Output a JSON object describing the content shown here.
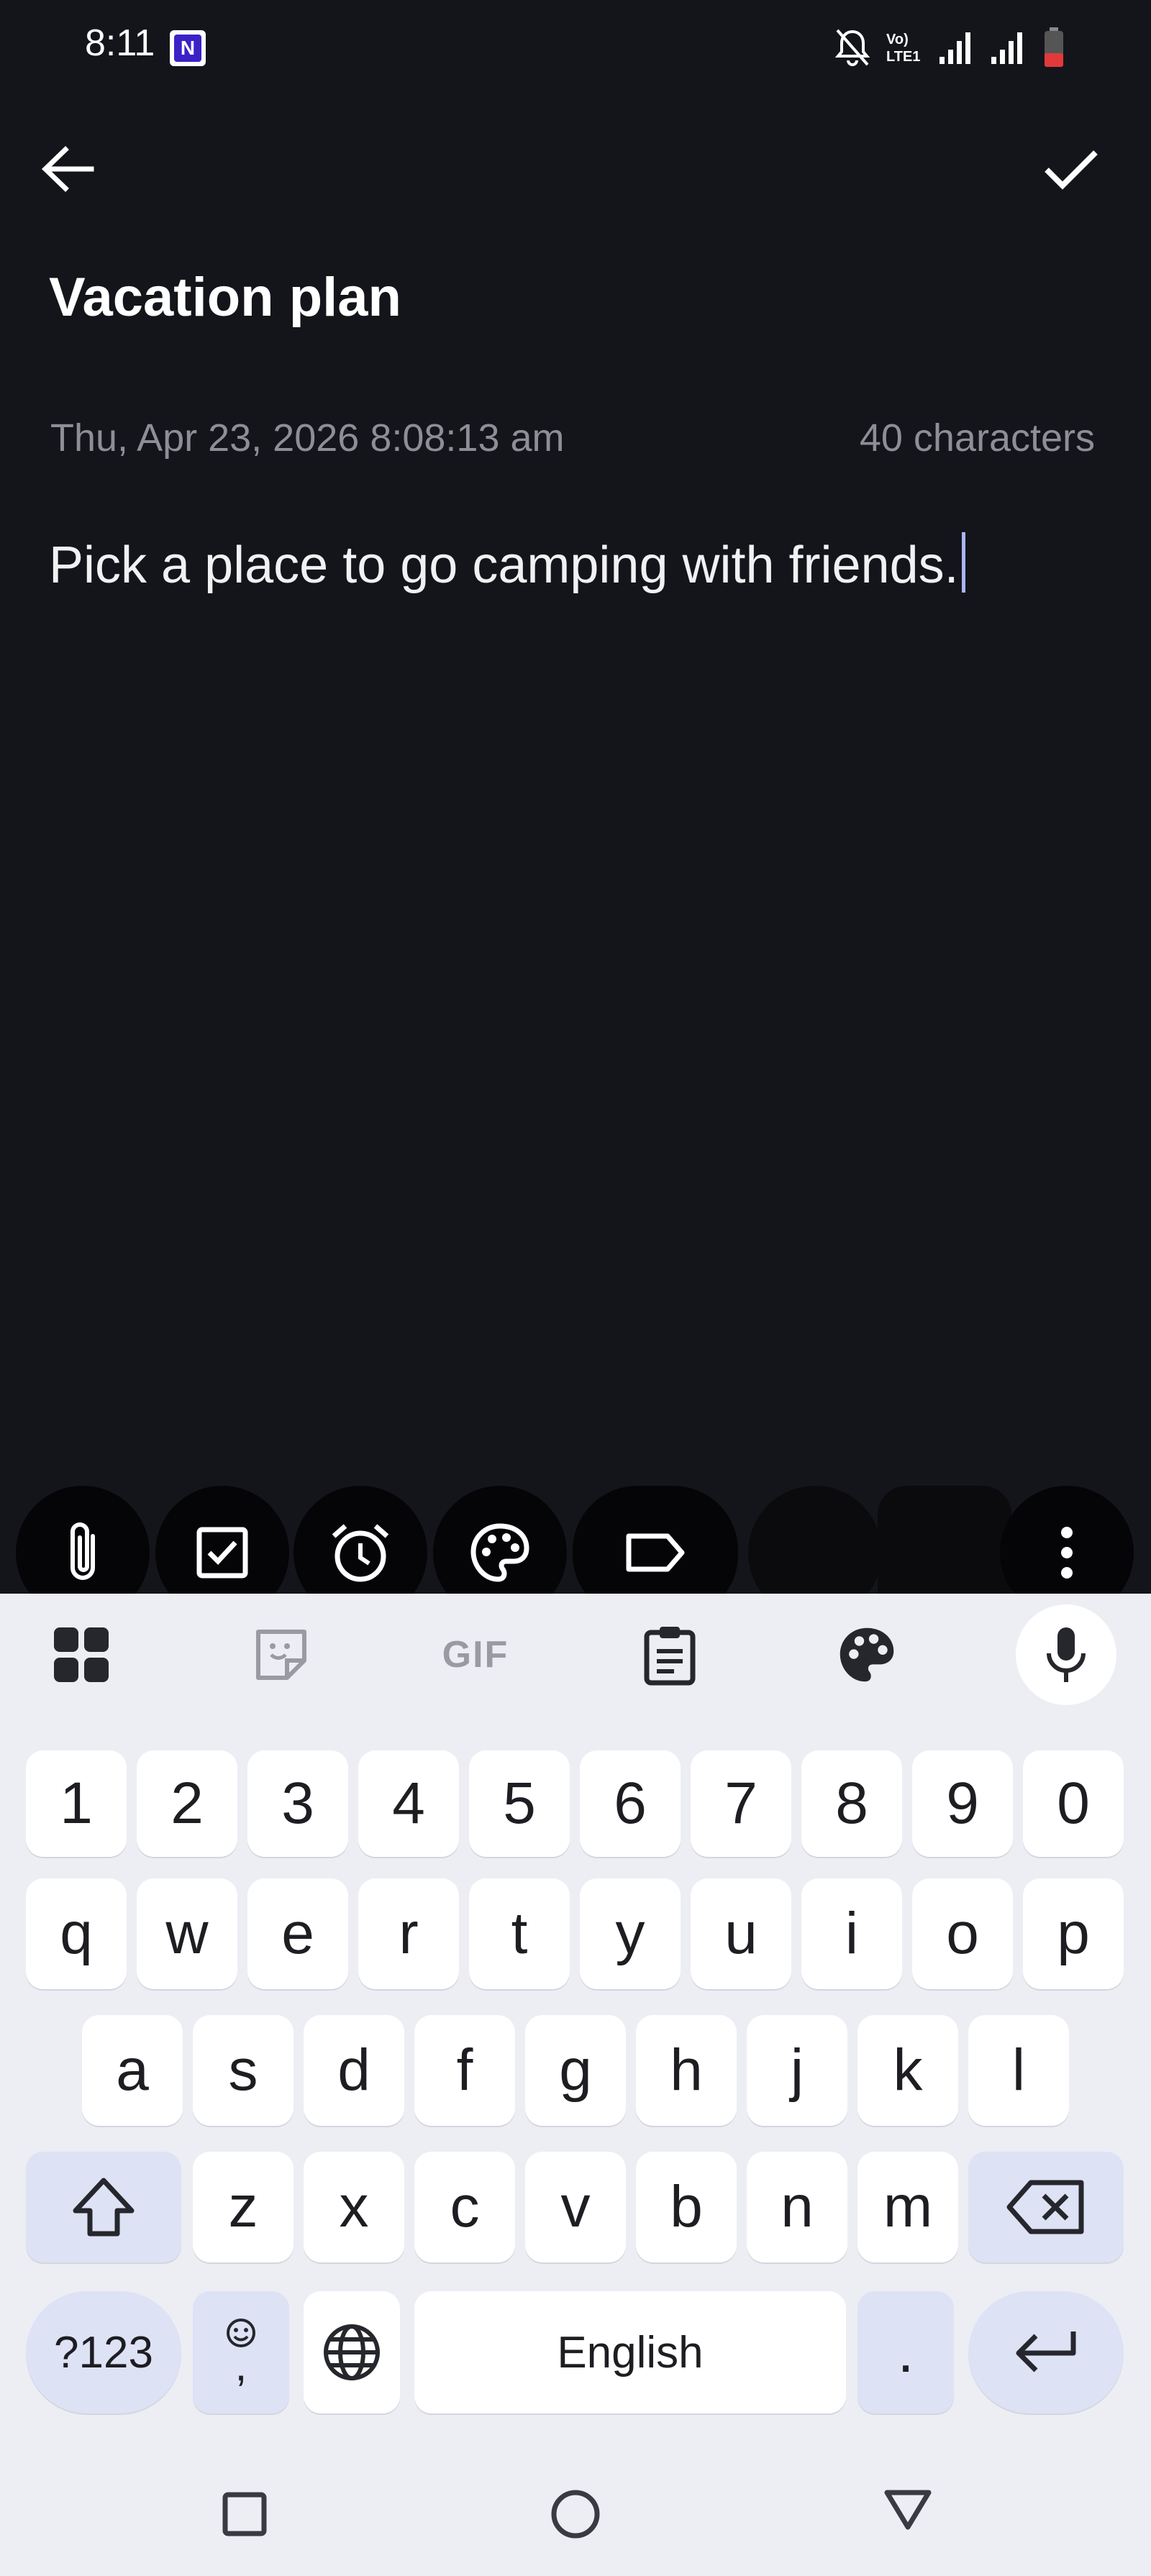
{
  "status": {
    "time": "8:11",
    "notif_app": "N",
    "icons": [
      "mute-bell-icon",
      "volte-icon",
      "signal-1-icon",
      "signal-2-icon",
      "battery-low-icon"
    ]
  },
  "header": {
    "back_icon": "arrow-left-icon",
    "confirm_icon": "checkmark-icon"
  },
  "note": {
    "title": "Vacation plan",
    "date": "Thu, Apr 23, 2026 8:08:13 am",
    "char_count": "40 characters",
    "body": "Pick a place to go camping with friends."
  },
  "toolbar": [
    "attachment-icon",
    "checkbox-icon",
    "alarm-icon",
    "palette-icon",
    "label-icon",
    "more-vert-icon"
  ],
  "keyboard": {
    "top_row": [
      "apps-grid-icon",
      "sticker-icon",
      "gif-icon",
      "clipboard-icon",
      "palette-icon",
      "mic-icon"
    ],
    "gif_label": "GIF",
    "row_numbers": [
      "1",
      "2",
      "3",
      "4",
      "5",
      "6",
      "7",
      "8",
      "9",
      "0"
    ],
    "row1": [
      "q",
      "w",
      "e",
      "r",
      "t",
      "y",
      "u",
      "i",
      "o",
      "p"
    ],
    "row2": [
      "a",
      "s",
      "d",
      "f",
      "g",
      "h",
      "j",
      "k",
      "l"
    ],
    "row3": [
      "z",
      "x",
      "c",
      "v",
      "b",
      "n",
      "m"
    ],
    "symbols_label": "?123",
    "emoji_comma": ",",
    "space_label": "English",
    "period": ".",
    "accent_color": "#dde2f5"
  },
  "navigation": [
    "recents-square-icon",
    "home-circle-icon",
    "back-triangle-icon"
  ]
}
